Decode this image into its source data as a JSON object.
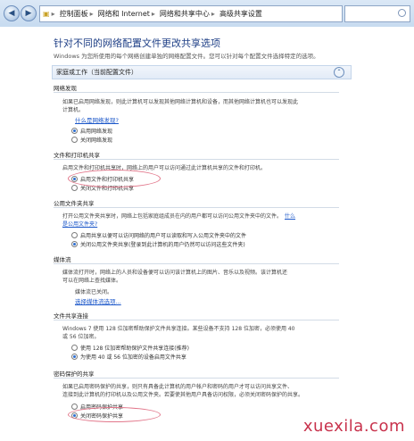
{
  "address_bar": {
    "segments": [
      "控制面板",
      "网络和 Internet",
      "网络和共享中心",
      "高级共享设置"
    ]
  },
  "main": {
    "title": "针对不同的网络配置文件更改共享选项",
    "subtitle": "Windows 为您所使用的每个网络创建单独的网络配置文件。您可以针对每个配置文件选择特定的选项。",
    "profile_header": "家庭或工作（当前配置文件）",
    "sections": [
      {
        "heading": "网络发现",
        "desc": [
          "如果已启用网络发现，则此计算机可以发现其他网络计算机和设备，而其他网络计算机也可以发现此",
          "计算机。"
        ],
        "link": "什么是网络发现?",
        "options": [
          "启用网络发现",
          "关闭网络发现"
        ],
        "selected": 0
      },
      {
        "heading": "文件和打印机共享",
        "desc": [
          "启用文件和打印机共享时，网络上的用户可以访问通过此计算机共享的文件和打印机。"
        ],
        "options": [
          "启用文件和打印机共享",
          "关闭文件和打印机共享"
        ],
        "selected": 0
      },
      {
        "heading": "公用文件夹共享",
        "desc": [
          "打开公用文件夹共享时，网络上包括家庭组成员在内的用户都可以访问公用文件夹中的文件。"
        ],
        "link_inline": "什么",
        "link": "是公用文件夹?",
        "options": [
          "启用共享以便可以访问网络的用户可以读取和写入公用文件夹中的文件",
          "关闭公用文件夹共享(登录到此计算机的用户仍然可以访问这些文件夹)"
        ],
        "selected": 1
      },
      {
        "heading": "媒体流",
        "desc": [
          "媒体流打开时，网络上的人员和设备便可以访问该计算机上的图片、音乐以及视频。该计算机还",
          "可以在网络上查找媒体。"
        ],
        "status": "媒体流已关闭。",
        "link": "选择媒体流选项..."
      },
      {
        "heading": "文件共享连接",
        "desc": [
          "Windows 7 使用 128 位加密帮助保护文件共享连接。某些设备不支持 128 位加密，必须使用 40",
          "或 56 位加密。"
        ],
        "options": [
          "使用 128 位加密帮助保护文件共享连接(推荐)",
          "为使用 40 或 56 位加密的设备启用文件共享"
        ],
        "selected": 1
      },
      {
        "heading": "密码保护的共享",
        "desc": [
          "如果已启用密码保护的共享，则只有具备此计算机的用户帐户和密码的用户才可以访问共享文件、",
          "连接到此计算机的打印机以及公用文件夹。若要使其他用户具备访问权限，必须关闭密码保护的共享。"
        ],
        "options": [
          "启用密码保护共享",
          "关闭密码保护共享"
        ],
        "selected": 1
      }
    ]
  },
  "watermark": "xuexila.com"
}
